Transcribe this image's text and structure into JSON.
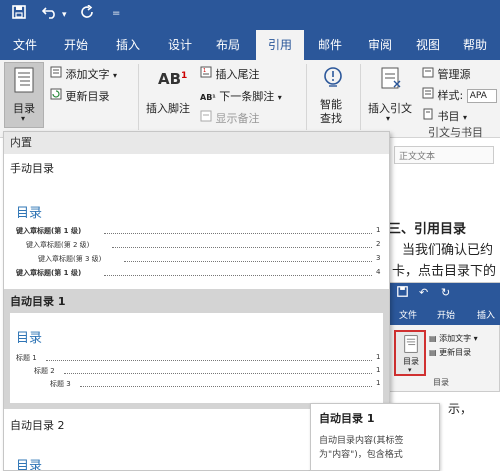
{
  "qat": {
    "save_icon": "save-icon",
    "undo_icon": "undo-icon",
    "redo_icon": "redo-icon",
    "customize_icon": "customize-icon"
  },
  "tabs": [
    "文件",
    "开始",
    "插入",
    "设计",
    "布局",
    "引用",
    "邮件",
    "审阅",
    "视图",
    "帮助"
  ],
  "active_tab": "引用",
  "ribbon": {
    "toc_button": "目录",
    "add_text": "添加文字",
    "update_toc": "更新目录",
    "footnote_group_label": "AB",
    "footnote_super": "1",
    "insert_footnote": "插入脚注",
    "insert_endnote": "插入尾注",
    "next_footnote": "下一条脚注",
    "show_notes": "显示备注",
    "smart_lookup_1": "智能",
    "smart_lookup_2": "查找",
    "insert_citation": "插入引文",
    "manage_sources": "管理源",
    "style_label": "样式:",
    "style_value": "APA",
    "bibliography": "书目",
    "group_citations": "引文与书目"
  },
  "dropdown": {
    "builtin_header": "内置",
    "manual_toc": "手动目录",
    "manual_preview": {
      "title": "目录",
      "lines": [
        {
          "text": "键入章标题(第 1 级)",
          "num": "1"
        },
        {
          "text": "键入章标题(第 2 级)",
          "num": "2"
        },
        {
          "text": "键入章标题(第 3 级)",
          "num": "3"
        },
        {
          "text": "键入章标题(第 1 级)",
          "num": "4"
        }
      ]
    },
    "auto_toc1": "自动目录 1",
    "auto1_preview": {
      "title": "目录",
      "lines": [
        {
          "text": "标题 1",
          "num": "1"
        },
        {
          "text": "标题 2",
          "num": "1"
        },
        {
          "text": "标题 3",
          "num": "1"
        }
      ]
    },
    "auto_toc2": "自动目录 2",
    "auto2_title": "目录"
  },
  "document": {
    "text_heading": "三、引用目录",
    "text_line1": "当我们确认已约",
    "text_line2": "卡，点击目录下的",
    "style_box": "正文文本"
  },
  "inset": {
    "tabs": [
      "文件",
      "开始",
      "插入"
    ],
    "toc_button": "目录",
    "add_text": "添加文字",
    "update_toc": "更新目录",
    "group": "目录",
    "doc_text": "示，"
  },
  "tooltip": {
    "title": "自动目录 1",
    "body_1": "自动目录内容(其标签",
    "body_2": "为\"内容\")，包含格式"
  },
  "colors": {
    "accent": "#2b579a",
    "toc_blue": "#2e74b5",
    "highlight": "#d03030"
  }
}
